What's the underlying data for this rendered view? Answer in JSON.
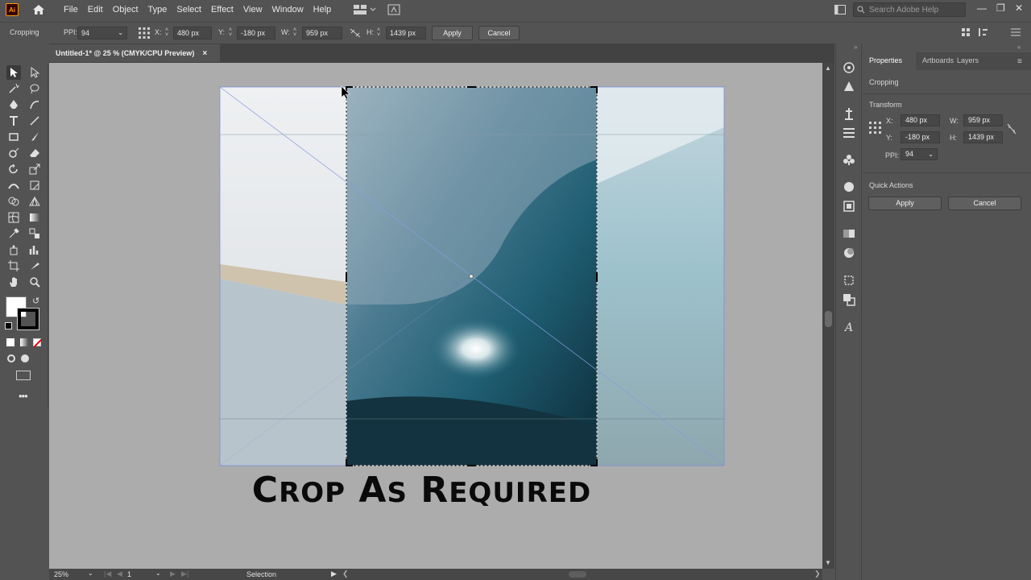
{
  "menubar": {
    "app_logo": "Ai",
    "items": [
      "File",
      "Edit",
      "Object",
      "Type",
      "Select",
      "Effect",
      "View",
      "Window",
      "Help"
    ],
    "search_placeholder": "Search Adobe Help"
  },
  "controlbar": {
    "mode": "Cropping",
    "ppi_label": "PPI:",
    "ppi_value": "94",
    "x_label": "X:",
    "x_value": "480 px",
    "y_label": "Y:",
    "y_value": "-180 px",
    "w_label": "W:",
    "w_value": "959 px",
    "h_label": "H:",
    "h_value": "1439 px",
    "apply": "Apply",
    "cancel": "Cancel"
  },
  "document": {
    "tab_title": "Untitled-1* @ 25 % (CMYK/CPU Preview)",
    "tab_close": "×"
  },
  "canvas": {
    "caption_parts": [
      {
        "big": "C",
        "small": "ROP"
      },
      {
        "big": "A",
        "small": "S"
      },
      {
        "big": "R",
        "small": "EQUIRED"
      }
    ]
  },
  "statusbar": {
    "zoom": "25%",
    "artboard": "1",
    "tool": "Selection"
  },
  "properties": {
    "tabs": [
      "Properties",
      "Artboards",
      "Layers"
    ],
    "active_tab": "Properties",
    "section_title": "Cropping",
    "transform_heading": "Transform",
    "x_label": "X:",
    "x_value": "480 px",
    "y_label": "Y:",
    "y_value": "-180 px",
    "w_label": "W:",
    "w_value": "959 px",
    "h_label": "H:",
    "h_value": "1439 px",
    "ppi_label": "PPI:",
    "ppi_value": "94",
    "quick_actions": "Quick Actions",
    "apply": "Apply",
    "cancel": "Cancel"
  },
  "colors": {
    "ui_bg": "#535353",
    "canvas_bg": "#acacac",
    "selection_blue": "#7b8fd6",
    "logo_orange": "#ff9a00"
  }
}
